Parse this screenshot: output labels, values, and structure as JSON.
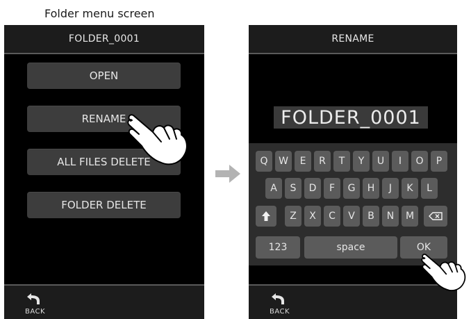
{
  "caption": "Folder menu screen",
  "left_screen": {
    "title": "FOLDER_0001",
    "buttons": [
      "OPEN",
      "RENAME",
      "ALL FILES DELETE",
      "FOLDER DELETE"
    ],
    "back_label": "BACK"
  },
  "right_screen": {
    "title": "RENAME",
    "name_value": "FOLDER_0001",
    "keyboard": {
      "row1": [
        "Q",
        "W",
        "E",
        "R",
        "T",
        "Y",
        "U",
        "I",
        "O",
        "P"
      ],
      "row2": [
        "A",
        "S",
        "D",
        "F",
        "G",
        "H",
        "J",
        "K",
        "L"
      ],
      "row3": [
        "Z",
        "X",
        "C",
        "V",
        "B",
        "N",
        "M"
      ],
      "numbers_label": "123",
      "space_label": "space",
      "ok_label": "OK"
    },
    "back_label": "BACK"
  },
  "icons": {
    "back": "back-arrow-icon",
    "shift": "shift-up-arrow-icon",
    "backspace": "backspace-icon",
    "flow_arrow": "right-arrow-icon",
    "pointer": "tapping-hand-icon"
  },
  "colors": {
    "screen_bg": "#000000",
    "bar_bg": "#1c1c1c",
    "button_bg": "#3d3d3d",
    "key_bg": "#5b5b5b",
    "keyboard_bg": "#2d2d2d",
    "arrow": "#b3b3b3"
  }
}
